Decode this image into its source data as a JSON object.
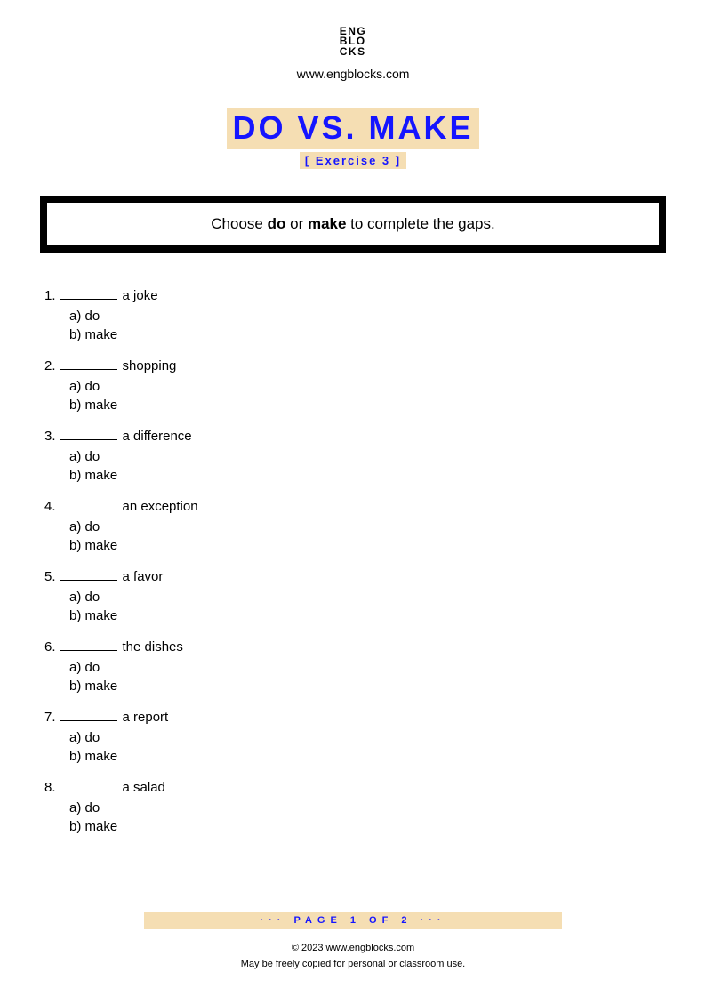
{
  "header": {
    "logo_line1": "ENG",
    "logo_line2": "BLO",
    "logo_line3": "CKS",
    "website": "www.engblocks.com"
  },
  "title": {
    "main": "DO VS. MAKE",
    "subtitle": "[ Exercise 3 ]"
  },
  "instructions": {
    "prefix": "Choose ",
    "word1": "do",
    "middle": " or ",
    "word2": "make",
    "suffix": " to complete the gaps."
  },
  "questions": [
    {
      "number": "1.",
      "text": "a joke",
      "options": [
        "a) do",
        "b) make"
      ]
    },
    {
      "number": "2.",
      "text": "shopping",
      "options": [
        "a) do",
        "b) make"
      ]
    },
    {
      "number": "3.",
      "text": "a difference",
      "options": [
        "a) do",
        "b) make"
      ]
    },
    {
      "number": "4.",
      "text": "an exception",
      "options": [
        "a) do",
        "b) make"
      ]
    },
    {
      "number": "5.",
      "text": "a favor",
      "options": [
        "a) do",
        "b) make"
      ]
    },
    {
      "number": "6.",
      "text": "the dishes",
      "options": [
        "a) do",
        "b) make"
      ]
    },
    {
      "number": "7.",
      "text": "a report",
      "options": [
        "a) do",
        "b) make"
      ]
    },
    {
      "number": "8.",
      "text": "a salad",
      "options": [
        "a) do",
        "b) make"
      ]
    }
  ],
  "footer": {
    "page_indicator": "··· PAGE 1 OF 2 ···",
    "copyright": "© 2023 www.engblocks.com",
    "usage": "May be freely copied for personal or classroom use."
  }
}
